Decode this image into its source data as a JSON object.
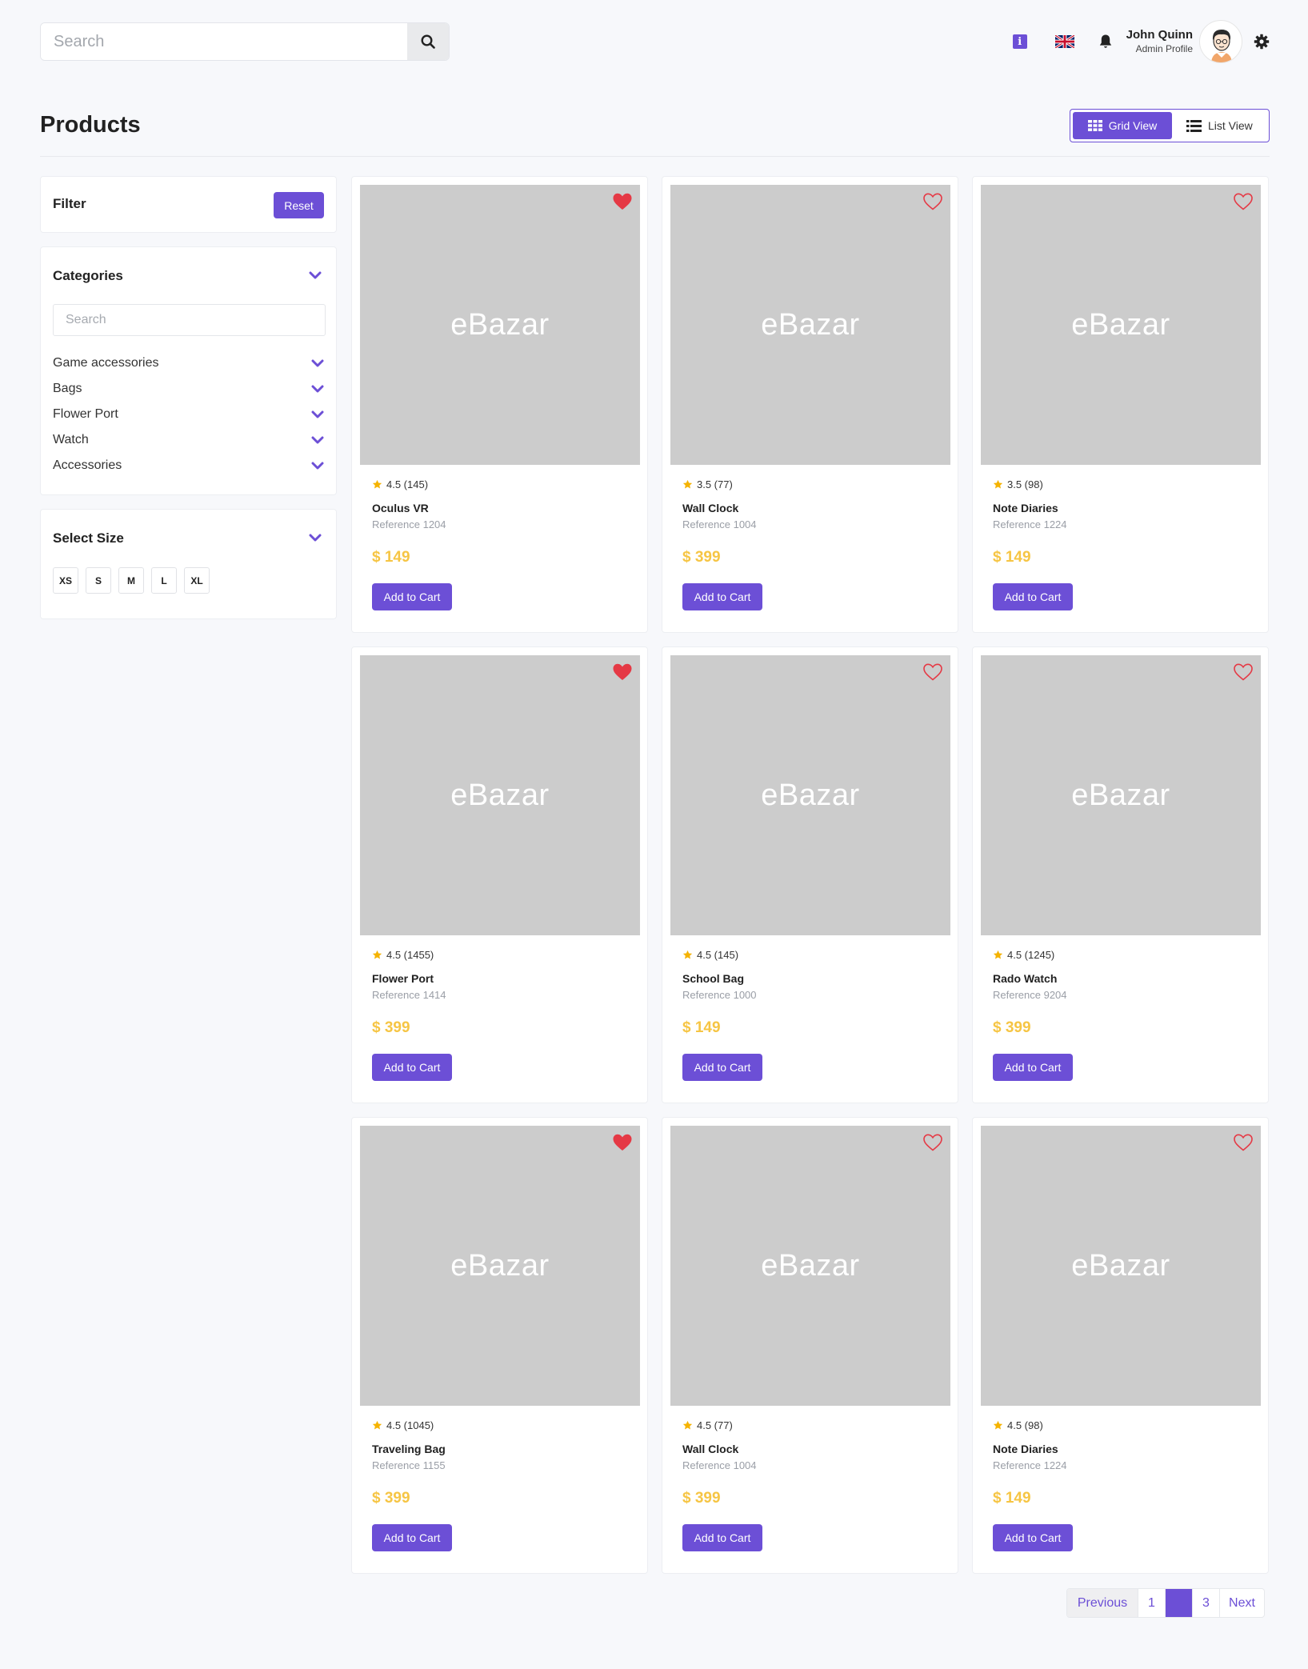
{
  "header": {
    "search_placeholder": "Search",
    "user_name": "John Quinn",
    "user_role": "Admin Profile"
  },
  "page": {
    "title": "Products",
    "grid_view_label": "Grid View",
    "list_view_label": "List View",
    "active_view": "grid"
  },
  "filter": {
    "title": "Filter",
    "reset_label": "Reset"
  },
  "categories": {
    "title": "Categories",
    "search_placeholder": "Search",
    "items": [
      "Game accessories",
      "Bags",
      "Flower Port",
      "Watch",
      "Accessories"
    ]
  },
  "sizes": {
    "title": "Select Size",
    "items": [
      "XS",
      "S",
      "M",
      "L",
      "XL"
    ]
  },
  "products": [
    {
      "name": "Oculus VR",
      "reference": "Reference 1204",
      "rating": "4.5 (145)",
      "price": "$ 149",
      "image_text": "eBazar",
      "favorite": true,
      "cart_label": "Add to Cart"
    },
    {
      "name": "Wall Clock",
      "reference": "Reference 1004",
      "rating": "3.5 (77)",
      "price": "$ 399",
      "image_text": "eBazar",
      "favorite": false,
      "cart_label": "Add to Cart"
    },
    {
      "name": "Note Diaries",
      "reference": "Reference 1224",
      "rating": "3.5 (98)",
      "price": "$ 149",
      "image_text": "eBazar",
      "favorite": false,
      "cart_label": "Add to Cart"
    },
    {
      "name": "Flower Port",
      "reference": "Reference 1414",
      "rating": "4.5 (1455)",
      "price": "$ 399",
      "image_text": "eBazar",
      "favorite": true,
      "cart_label": "Add to Cart"
    },
    {
      "name": "School Bag",
      "reference": "Reference 1000",
      "rating": "4.5 (145)",
      "price": "$ 149",
      "image_text": "eBazar",
      "favorite": false,
      "cart_label": "Add to Cart"
    },
    {
      "name": "Rado Watch",
      "reference": "Reference 9204",
      "rating": "4.5 (1245)",
      "price": "$ 399",
      "image_text": "eBazar",
      "favorite": false,
      "cart_label": "Add to Cart"
    },
    {
      "name": "Traveling Bag",
      "reference": "Reference 1155",
      "rating": "4.5 (1045)",
      "price": "$ 399",
      "image_text": "eBazar",
      "favorite": true,
      "cart_label": "Add to Cart"
    },
    {
      "name": "Wall Clock",
      "reference": "Reference 1004",
      "rating": "4.5 (77)",
      "price": "$ 399",
      "image_text": "eBazar",
      "favorite": false,
      "cart_label": "Add to Cart"
    },
    {
      "name": "Note Diaries",
      "reference": "Reference 1224",
      "rating": "4.5 (98)",
      "price": "$ 149",
      "image_text": "eBazar",
      "favorite": false,
      "cart_label": "Add to Cart"
    }
  ],
  "pagination": {
    "previous_label": "Previous",
    "pages": [
      "1",
      "",
      "3"
    ],
    "active_index": 1,
    "next_label": "Next"
  },
  "colors": {
    "accent": "#6c4fd6",
    "price": "#f6c544",
    "heart": "#e53945",
    "star": "#f5b300",
    "image_placeholder": "#cccccc"
  },
  "icons": {
    "search": "search-icon",
    "info": "info-icon",
    "flag": "uk-flag-icon",
    "bell": "bell-icon",
    "settings": "gear-icon",
    "grid": "grid-icon",
    "list": "list-icon",
    "chevron": "chevron-down-icon",
    "heart": "heart-icon",
    "star": "star-icon"
  }
}
